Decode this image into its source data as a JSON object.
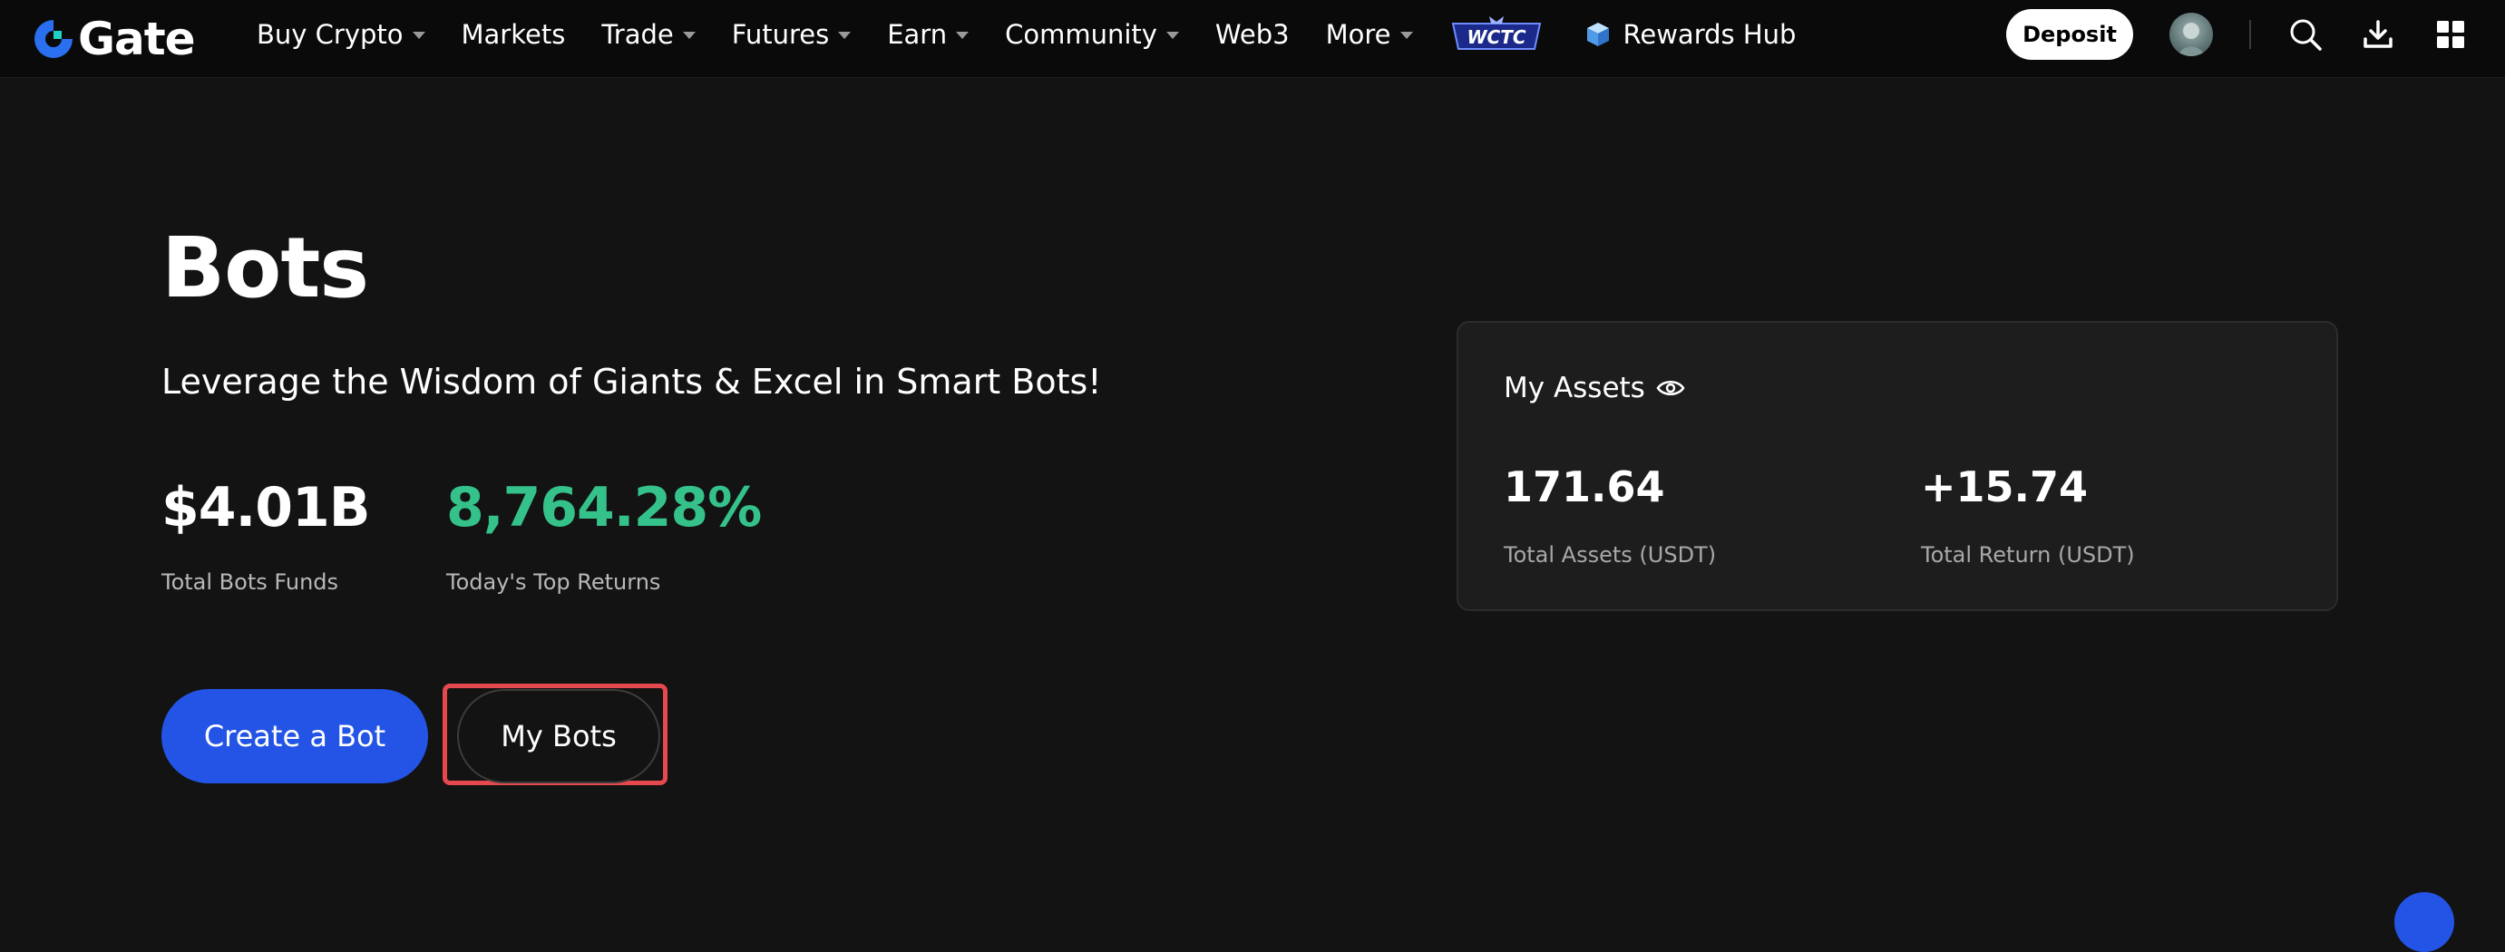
{
  "brand": {
    "name": "Gate",
    "colors": {
      "accent": "#2354e6",
      "positive": "#35c28a",
      "highlight": "#e5484d",
      "logo_blue": "#2a6ff0"
    }
  },
  "nav": {
    "items": [
      {
        "label": "Buy Crypto",
        "has_dropdown": true
      },
      {
        "label": "Markets",
        "has_dropdown": false
      },
      {
        "label": "Trade",
        "has_dropdown": true
      },
      {
        "label": "Futures",
        "has_dropdown": true
      },
      {
        "label": "Earn",
        "has_dropdown": true
      },
      {
        "label": "Community",
        "has_dropdown": true
      },
      {
        "label": "Web3",
        "has_dropdown": false
      },
      {
        "label": "More",
        "has_dropdown": true
      }
    ],
    "wctc_label": "WCTC",
    "rewards_label": "Rewards Hub",
    "deposit_label": "Deposit",
    "icons": [
      "search-icon",
      "download-icon",
      "apps-grid-icon"
    ]
  },
  "hero": {
    "title": "Bots",
    "subtitle": "Leverage the Wisdom of Giants & Excel in Smart Bots!",
    "stats": [
      {
        "value": "$4.01B",
        "label": "Total Bots Funds",
        "color": "#ffffff"
      },
      {
        "value": "8,764.28%",
        "label": "Today's Top Returns",
        "color": "#35c28a"
      }
    ],
    "create_label": "Create a Bot",
    "mybots_label": "My Bots"
  },
  "assets": {
    "title": "My Assets",
    "total_assets": {
      "value": "171.64",
      "label": "Total Assets (USDT)"
    },
    "total_return": {
      "value": "+15.74",
      "label": "Total Return (USDT)"
    }
  }
}
